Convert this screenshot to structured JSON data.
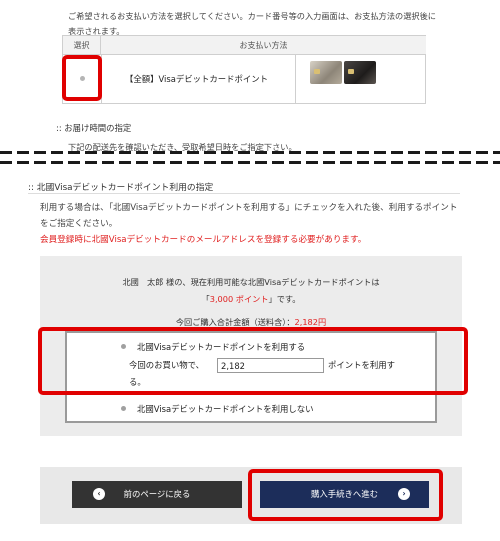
{
  "payment": {
    "instruction": "ご希望されるお支払い方法を選択してください。カード番号等の入力画面は、お支払方法の選択後に表示されます。",
    "col_select": "選択",
    "col_method": "お支払い方法",
    "method_label": "【全額】Visaデビットカードポイント"
  },
  "delivery": {
    "title": ":: お届け時間の指定",
    "note": "下記の配送先を確認いただき、受取希望日時をご指定下さい。"
  },
  "points_section": {
    "title": ":: 北國Visaデビットカードポイント利用の指定",
    "desc": "利用する場合は、「北國Visaデビットカードポイントを利用する」にチェックを入れた後、利用するポイントをご指定ください。",
    "warning": "会員登録時に北國Visaデビットカードのメールアドレスを登録する必要があります。"
  },
  "summary": {
    "line1_prefix": "北國　太郎 様の、現在利用可能な北國Visaデビットカードポイントは「",
    "points_value": "3,000 ポイント",
    "line1_suffix": "」です。",
    "total_label": "今回ご購入合計金額（送料含）：",
    "total_value": "2,182円"
  },
  "options": {
    "use_label": "北國Visaデビットカードポイントを利用する",
    "amount_prefix": "今回のお買い物で、",
    "amount_value": "2,182",
    "amount_suffix": "ポイントを利用す",
    "amount_suffix2": "る。",
    "no_use_label": "北國Visaデビットカードポイントを利用しない"
  },
  "buttons": {
    "back_label": "前のページに戻る",
    "next_label": "購入手続きへ進む",
    "back_icon": "chevron-left-icon",
    "next_icon": "chevron-right-icon"
  },
  "colors": {
    "highlight": "#e00000",
    "warning_text": "#e02020",
    "next_button": "#1c2d5a",
    "back_button": "#333333"
  }
}
